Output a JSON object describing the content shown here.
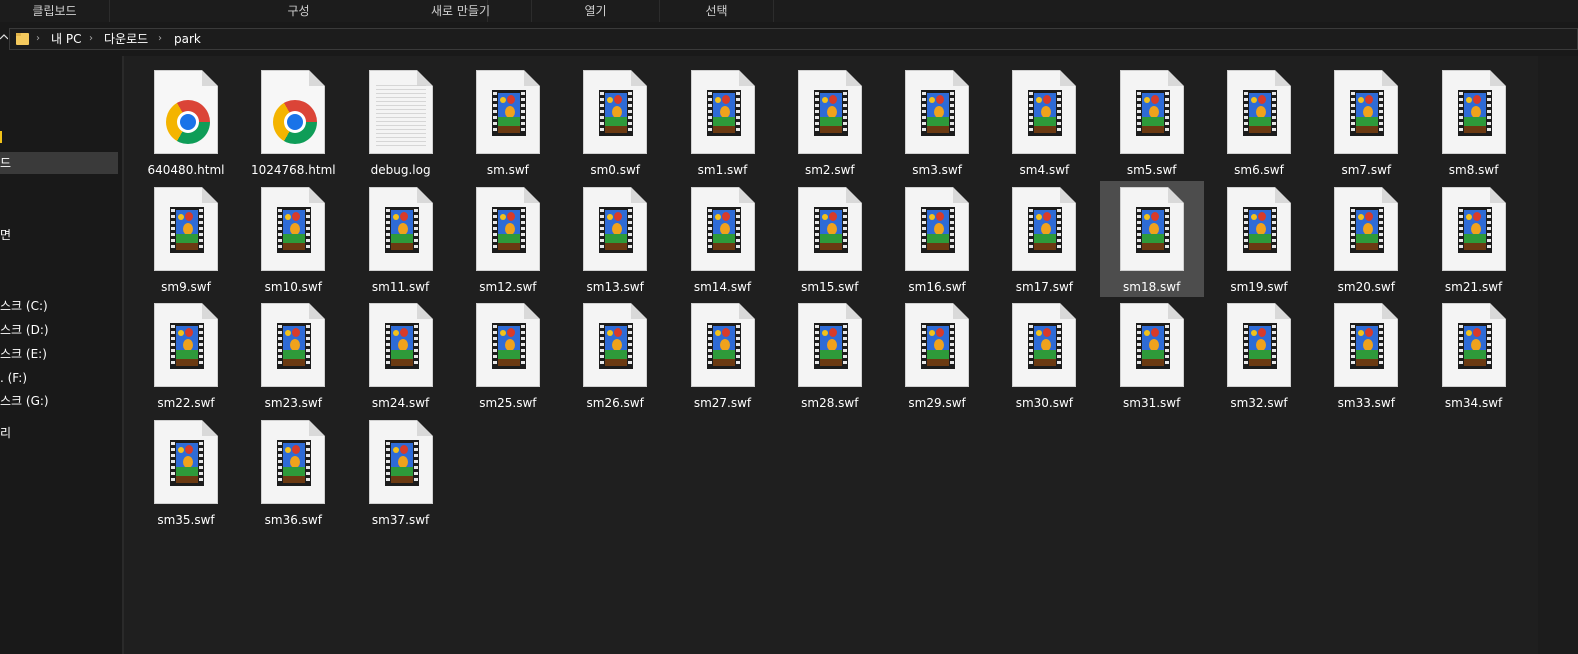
{
  "ribbon": {
    "groups": [
      "클립보드",
      "구성",
      "새로 만들기",
      "열기",
      "선택"
    ]
  },
  "address": {
    "breadcrumbs": [
      "내 PC",
      "다운로드",
      "park"
    ]
  },
  "nav": {
    "items": [
      "",
      "드",
      "",
      "면",
      "",
      "스크 (C:)",
      "스크 (D:)",
      "스크 (E:)",
      ". (F:)",
      "스크 (G:)",
      "리"
    ]
  },
  "files": {
    "items": [
      {
        "name": "640480.html",
        "type": "chrome-html"
      },
      {
        "name": "1024768.html",
        "type": "chrome-html"
      },
      {
        "name": "debug.log",
        "type": "text"
      },
      {
        "name": "sm.swf",
        "type": "swf"
      },
      {
        "name": "sm0.swf",
        "type": "swf"
      },
      {
        "name": "sm1.swf",
        "type": "swf"
      },
      {
        "name": "sm2.swf",
        "type": "swf"
      },
      {
        "name": "sm3.swf",
        "type": "swf"
      },
      {
        "name": "sm4.swf",
        "type": "swf"
      },
      {
        "name": "sm5.swf",
        "type": "swf"
      },
      {
        "name": "sm6.swf",
        "type": "swf"
      },
      {
        "name": "sm7.swf",
        "type": "swf"
      },
      {
        "name": "sm8.swf",
        "type": "swf"
      },
      {
        "name": "sm9.swf",
        "type": "swf"
      },
      {
        "name": "sm10.swf",
        "type": "swf"
      },
      {
        "name": "sm11.swf",
        "type": "swf"
      },
      {
        "name": "sm12.swf",
        "type": "swf"
      },
      {
        "name": "sm13.swf",
        "type": "swf"
      },
      {
        "name": "sm14.swf",
        "type": "swf"
      },
      {
        "name": "sm15.swf",
        "type": "swf"
      },
      {
        "name": "sm16.swf",
        "type": "swf"
      },
      {
        "name": "sm17.swf",
        "type": "swf"
      },
      {
        "name": "sm18.swf",
        "type": "swf",
        "selected": true
      },
      {
        "name": "sm19.swf",
        "type": "swf"
      },
      {
        "name": "sm20.swf",
        "type": "swf"
      },
      {
        "name": "sm21.swf",
        "type": "swf"
      },
      {
        "name": "sm22.swf",
        "type": "swf"
      },
      {
        "name": "sm23.swf",
        "type": "swf"
      },
      {
        "name": "sm24.swf",
        "type": "swf"
      },
      {
        "name": "sm25.swf",
        "type": "swf"
      },
      {
        "name": "sm26.swf",
        "type": "swf"
      },
      {
        "name": "sm27.swf",
        "type": "swf"
      },
      {
        "name": "sm28.swf",
        "type": "swf"
      },
      {
        "name": "sm29.swf",
        "type": "swf"
      },
      {
        "name": "sm30.swf",
        "type": "swf"
      },
      {
        "name": "sm31.swf",
        "type": "swf"
      },
      {
        "name": "sm32.swf",
        "type": "swf"
      },
      {
        "name": "sm33.swf",
        "type": "swf"
      },
      {
        "name": "sm34.swf",
        "type": "swf"
      },
      {
        "name": "sm35.swf",
        "type": "swf"
      },
      {
        "name": "sm36.swf",
        "type": "swf"
      },
      {
        "name": "sm37.swf",
        "type": "swf"
      }
    ]
  },
  "colors": {
    "background": "#1f1f1f",
    "selection": "#4d4d4d",
    "quick_access_star": "#f2c218",
    "folder": "#f4c95d"
  }
}
